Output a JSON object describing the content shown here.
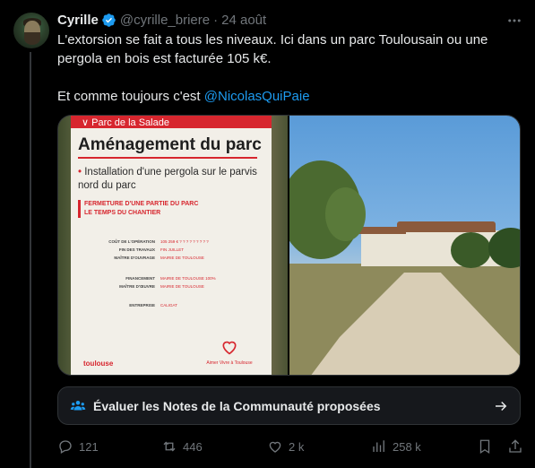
{
  "tweet": {
    "author_name": "Cyrille",
    "handle": "@cyrille_briere",
    "separator": "·",
    "date": "24 août",
    "text_line1": "L'extorsion se fait a tous les niveaux. Ici dans un parc Toulousain ou une",
    "text_line2": "pergola en bois est facturée 105 k€.",
    "text_line3_prefix": "Et comme toujours c'est ",
    "mention": "@NicolasQuiPaie"
  },
  "sign": {
    "band": "Parc de la Salade",
    "title": "Aménagement du parc",
    "bullet": "Installation d'une pergola sur le parvis nord du parc",
    "closure_line1": "FERMETURE D'UNE PARTIE DU PARC",
    "closure_line2": "LE TEMPS DU CHANTIER",
    "rows": [
      {
        "k": "COÛT DE L'OPÉRATION",
        "v": "105 259 € ? ? ? ? ? ? ? ? ?"
      },
      {
        "k": "FIN DES TRAVAUX",
        "v": "FIN JUILLET"
      },
      {
        "k": "MAÎTRE D'OUVRAGE",
        "v": "MAIRIE DE TOULOUSE"
      },
      {
        "k": "FINANCEMENT",
        "v": "MAIRIE DE TOULOUSE 100%"
      },
      {
        "k": "MAÎTRE D'ŒUVRE",
        "v": "MAIRIE DE TOULOUSE"
      },
      {
        "k": "ENTREPRISE",
        "v": "CALIGAT"
      }
    ],
    "logo_left": "toulouse",
    "logo_right": "Aimer Vivre à Toulouse"
  },
  "notes_button": {
    "label": "Évaluer les Notes de la Communauté proposées"
  },
  "actions": {
    "replies": "121",
    "reposts": "446",
    "likes": "2 k",
    "views": "258 k"
  },
  "colors": {
    "background": "#000000",
    "accent": "#1d9bf0",
    "muted": "#71767b",
    "sign_red": "#d7262e"
  }
}
